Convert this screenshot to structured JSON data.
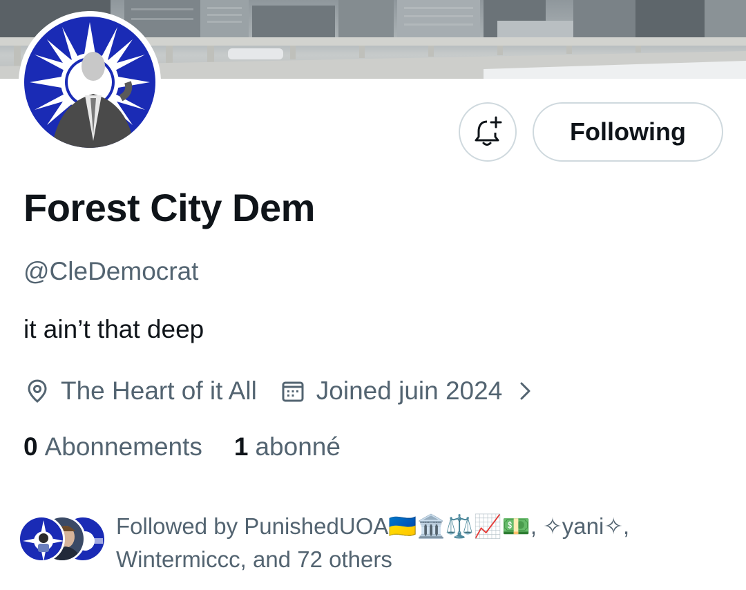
{
  "profile": {
    "display_name": "Forest City Dem",
    "handle": "@CleDemocrat",
    "bio": "it ain’t that deep",
    "location": "The Heart of it All",
    "joined": "Joined juin 2024"
  },
  "actions": {
    "notify_icon": "bell-plus-icon",
    "follow_label": "Following"
  },
  "stats": {
    "following_count": "0",
    "following_label": "Abonnements",
    "followers_count": "1",
    "followers_label": "abonné"
  },
  "followed_by": {
    "text_line1": "Followed by PunishedUOA🇺🇦🏛️⚖️📈💵, ✧yani✧,",
    "text_line2": "Wintermiccc, and 72 others"
  },
  "icons": {
    "location": "location-pin-icon",
    "calendar": "calendar-icon",
    "chevron": "chevron-right-icon"
  },
  "colors": {
    "text_primary": "#0f1419",
    "text_secondary": "#536471",
    "border": "#cfd9de",
    "flag_blue": "#1a2bb5"
  }
}
